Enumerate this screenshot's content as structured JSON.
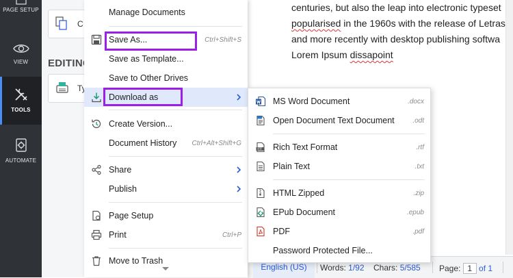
{
  "left_rail": {
    "items": [
      {
        "label": "PAGE SETUP",
        "icon": "page-setup-icon"
      },
      {
        "label": "VIEW",
        "icon": "eye-icon"
      },
      {
        "label": "TOOLS",
        "icon": "tools-icon"
      },
      {
        "label": "AUTOMATE",
        "icon": "automate-icon"
      }
    ],
    "active": "TOOLS"
  },
  "panel": {
    "card1_text": "C",
    "heading": "EDITING",
    "card2_text": "Ty"
  },
  "document": {
    "lines": [
      {
        "before": "centuries, but also the leap into electronic typeset",
        "squiggle": "",
        "after": ""
      },
      {
        "before": "",
        "squiggle": "popularised",
        "after": " in the 1960s with the release of Letras"
      },
      {
        "before": "and more recently with desktop publishing softwa",
        "squiggle": "",
        "after": ""
      },
      {
        "before": "Lorem Ipsum ",
        "squiggle": "dissapoint",
        "after": ""
      }
    ]
  },
  "file_menu": {
    "items": [
      {
        "label": "Manage Documents",
        "shortcut": "",
        "icon": "",
        "has_submenu": false
      },
      {
        "label": "Save As...",
        "shortcut": "Ctrl+Shift+S",
        "icon": "save-icon",
        "has_submenu": false
      },
      {
        "label": "Save as Template...",
        "shortcut": "",
        "icon": "",
        "has_submenu": false
      },
      {
        "label": "Save to Other Drives",
        "shortcut": "",
        "icon": "",
        "has_submenu": false
      },
      {
        "label": "Download as",
        "shortcut": "",
        "icon": "download-icon",
        "has_submenu": true
      },
      {
        "label": "Create Version...",
        "shortcut": "",
        "icon": "version-history-icon",
        "has_submenu": false
      },
      {
        "label": "Document History",
        "shortcut": "Ctrl+Alt+Shift+G",
        "icon": "",
        "has_submenu": false
      },
      {
        "label": "Share",
        "shortcut": "",
        "icon": "share-icon",
        "has_submenu": true
      },
      {
        "label": "Publish",
        "shortcut": "",
        "icon": "",
        "has_submenu": true
      },
      {
        "label": "Page Setup",
        "shortcut": "",
        "icon": "page-setup-icon",
        "has_submenu": false
      },
      {
        "label": "Print",
        "shortcut": "Ctrl+P",
        "icon": "printer-icon",
        "has_submenu": false
      },
      {
        "label": "Move to Trash",
        "shortcut": "",
        "icon": "trash-icon",
        "has_submenu": false
      }
    ],
    "highlighted": "Download as",
    "more_indicator": "chevron-down-icon"
  },
  "download_submenu": {
    "items": [
      {
        "label": "MS Word Document",
        "ext": ".docx",
        "icon": "word-doc-icon"
      },
      {
        "label": "Open Document Text Document",
        "ext": ".odt",
        "icon": "odt-doc-icon"
      },
      {
        "label": "Rich Text Format",
        "ext": ".rtf",
        "icon": "rtf-doc-icon"
      },
      {
        "label": "Plain Text",
        "ext": ".txt",
        "icon": "txt-doc-icon"
      },
      {
        "label": "HTML Zipped",
        "ext": ".zip",
        "icon": "zip-icon"
      },
      {
        "label": "EPub Document",
        "ext": ".epub",
        "icon": "epub-icon"
      },
      {
        "label": "PDF",
        "ext": ".pdf",
        "icon": "pdf-icon"
      },
      {
        "label": "Password Protected File...",
        "ext": "",
        "icon": ""
      }
    ]
  },
  "status_bar": {
    "language": "English (US)",
    "words_label": "Words:",
    "words_value": "1/92",
    "chars_label": "Chars:",
    "chars_value": "5/585",
    "page_label": "Page:",
    "page_current": "1",
    "page_total": "of 1"
  },
  "colors": {
    "rail_bg": "#2f3236",
    "accent": "#4a8ef5",
    "annotation_box": "#9b20e6",
    "menu_highlight": "#dfe9fb",
    "link_blue": "#2a5bd7"
  }
}
